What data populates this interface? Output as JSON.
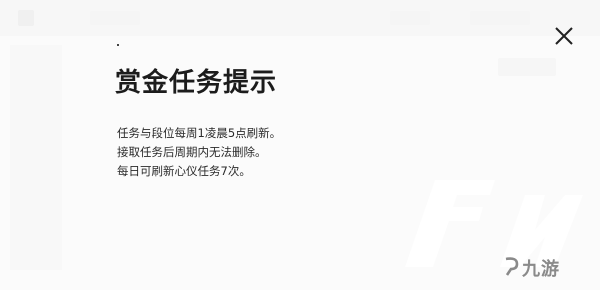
{
  "background": {
    "back_label": "返回"
  },
  "modal": {
    "title": "赏金任务提示",
    "lines": [
      "任务与段位每周1凌晨5点刷新。",
      "接取任务后周期内无法删除。",
      "每日可刷新心仪任务7次。"
    ],
    "close_icon": "close-icon"
  },
  "watermark": {
    "text": "九游"
  },
  "colors": {
    "title": "#1c1c1c",
    "body_text": "#2a2a2a",
    "overlay": "#ffffff"
  }
}
